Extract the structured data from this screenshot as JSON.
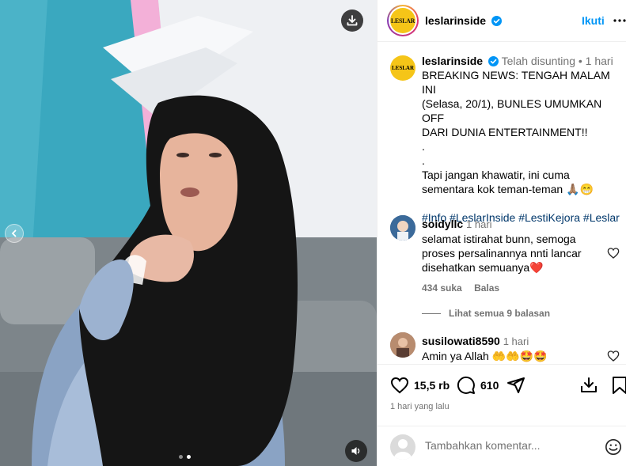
{
  "post": {
    "username": "leslarinside",
    "logo_text": "LESLAR",
    "follow_label": "Ikuti",
    "caption": {
      "username": "leslarinside",
      "edited_label": "Telah disunting",
      "time": "1 hari",
      "lines": [
        "BREAKING NEWS: TENGAH MALAM INI",
        "(Selasa, 20/1), BUNLES UMUMKAN OFF",
        "DARI DUNIA ENTERTAINMENT!!",
        ".",
        ".",
        "Tapi jangan khawatir, ini cuma",
        "sementara kok teman-teman 🙏🏽😁"
      ],
      "hashtags": "#Info #LeslarInside #LestiKejora #Leslar"
    },
    "comments": [
      {
        "username": "soidyllc",
        "time": "1 hari",
        "lines": [
          "selamat istirahat bunn, semoga",
          "proses persalinannya nnti lancar",
          "disehatkan semuanya❤️"
        ],
        "likes": "434 suka",
        "reply_label": "Balas",
        "view_replies": "Lihat semua 9 balasan"
      },
      {
        "username": "susilowati8590",
        "time": "1 hari",
        "lines": [
          "Amin ya Allah 🤲🤲🤩🤩"
        ]
      }
    ],
    "likes_count": "15,5 rb",
    "comments_count": "610",
    "posted": "1 hari yang lalu",
    "composer_placeholder": "Tambahkan komentar..."
  },
  "colors": {
    "link": "#0095f6",
    "hashtag": "#00376b",
    "muted": "#737373",
    "verified": "#0095f6",
    "heart": "#ed4956"
  },
  "media": {
    "slide_count": 2,
    "active_slide": 2
  }
}
